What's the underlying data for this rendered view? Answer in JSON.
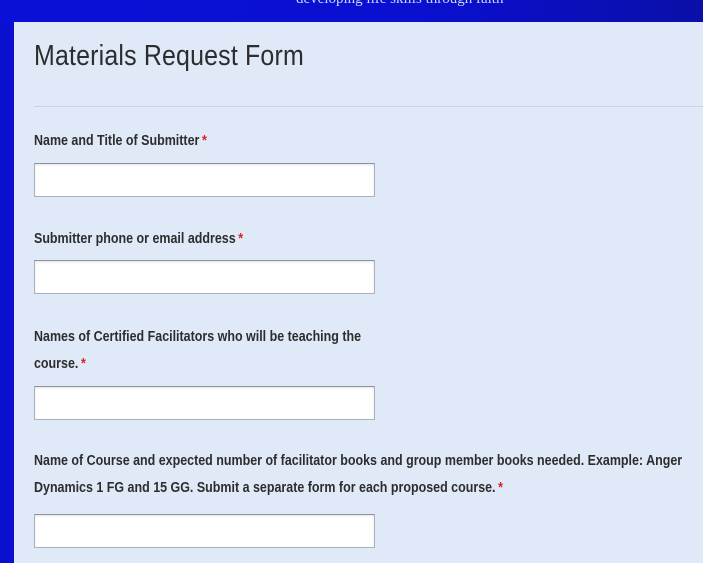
{
  "header": {
    "tagline": "developing life skills through faith"
  },
  "form": {
    "title": "Materials Request Form",
    "required_marker": "*",
    "fields": [
      {
        "label": "Name and Title of Submitter",
        "value": ""
      },
      {
        "label": "Submitter phone or email address",
        "value": ""
      },
      {
        "label": "Names of Certified Facilitators who will be teaching the course.",
        "value": ""
      },
      {
        "label": "Name of Course and expected number of facilitator books and group member books needed. Example: Anger Dynamics 1 FG and 15 GG. Submit a separate form for each proposed course.",
        "value": ""
      }
    ]
  }
}
